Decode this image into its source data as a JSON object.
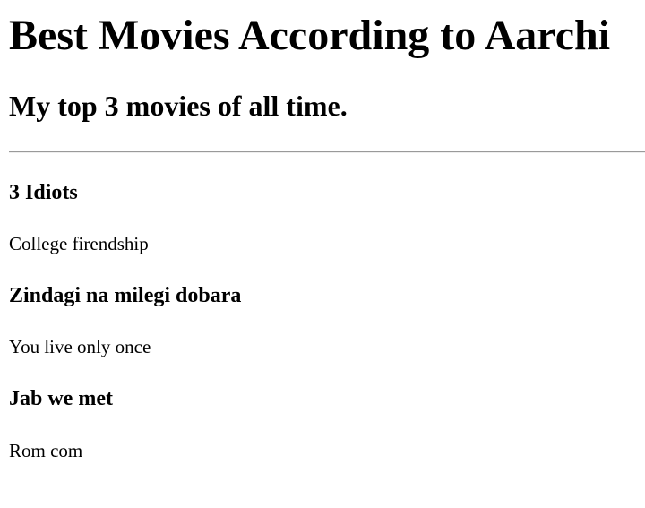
{
  "page": {
    "title": "Best Movies According to Aarchi",
    "subtitle": "My top 3 movies of all time."
  },
  "movies": [
    {
      "title": "3 Idiots",
      "description": "College firendship"
    },
    {
      "title": "Zindagi na milegi dobara",
      "description": "You live only once"
    },
    {
      "title": "Jab we met",
      "description": "Rom com"
    }
  ]
}
